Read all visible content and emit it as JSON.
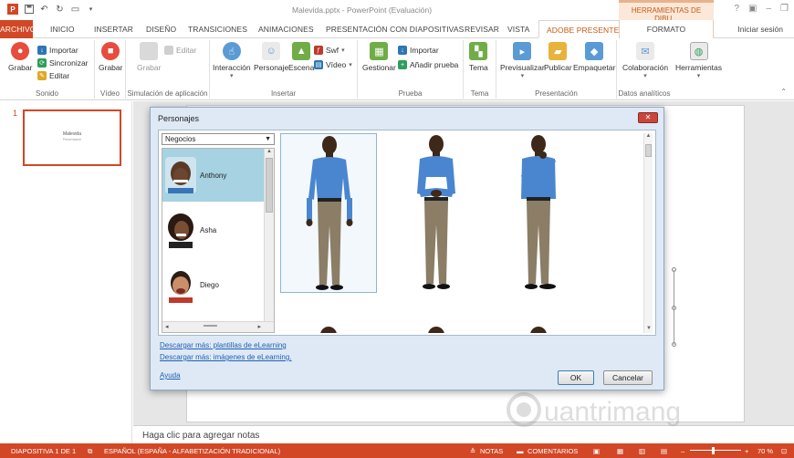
{
  "title_bar": {
    "doc_title": "Malevida.pptx - PowerPoint (Evaluación)",
    "contextual_group": "HERRAMIENTAS DE DIBU...",
    "help_glyph": "?"
  },
  "tabs": {
    "file": "ARCHIVO",
    "items": [
      "INICIO",
      "INSERTAR",
      "DISEÑO",
      "TRANSICIONES",
      "ANIMACIONES",
      "PRESENTACIÓN CON DIAPOSITIVAS",
      "REVISAR",
      "VISTA"
    ],
    "active": "ADOBE PRESENTER",
    "contextual": "FORMATO",
    "sign_in": "Iniciar sesión"
  },
  "ribbon": {
    "sonido": {
      "label": "Sonido",
      "grabar": "Grabar",
      "importar": "Importar",
      "sincronizar": "Sincronizar",
      "editar": "Editar"
    },
    "video": {
      "label": "Vídeo",
      "grabar": "Grabar"
    },
    "simulacion": {
      "label": "Simulación de aplicación",
      "grabar": "Grabar",
      "editar": "Editar"
    },
    "insertar": {
      "label": "Insertar",
      "interaccion": "Interacción",
      "personaje": "Personaje",
      "escena": "Escena",
      "swf": "Swf",
      "video": "Vídeo"
    },
    "prueba": {
      "label": "Prueba",
      "gestionar": "Gestionar",
      "importar": "Importar",
      "anadir": "Añadir prueba"
    },
    "tema": {
      "label": "Tema",
      "tema": "Tema"
    },
    "presentacion": {
      "label": "Presentación",
      "previsualizar": "Previsualizar",
      "publicar": "Publicar",
      "empaquetar": "Empaquetar"
    },
    "datos": {
      "label": "Datos analíticos",
      "colaboracion": "Colaboración",
      "herramientas": "Herramientas"
    }
  },
  "thumbnails": {
    "slide_number": "1",
    "thumb_title": "Malevida",
    "thumb_subtitle": "Presentación"
  },
  "notes_placeholder": "Haga clic para agregar notas",
  "dialog": {
    "title": "Personajes",
    "category": "Negocios",
    "characters": [
      {
        "name": "Anthony",
        "selected": true
      },
      {
        "name": "Asha",
        "selected": false
      },
      {
        "name": "Diego",
        "selected": false
      }
    ],
    "links": {
      "templates": "Descargar más: plantillas de eLearning",
      "images": "Descargar más: imágenes de eLearning.",
      "help": "Ayuda"
    },
    "ok": "OK",
    "cancel": "Cancelar"
  },
  "status_bar": {
    "slide_info": "DIAPOSITIVA 1 DE 1",
    "language": "ESPAÑOL (ESPAÑA - ALFABETIZACIÓN TRADICIONAL)",
    "notes": "NOTAS",
    "comments": "COMENTARIOS",
    "zoom": "70 %"
  },
  "colors": {
    "accent": "#d24726",
    "contextual": "#c55a11",
    "dialog_bg": "#dfe9f5",
    "selection": "#a6d2e1",
    "link": "#1f5fb4"
  }
}
